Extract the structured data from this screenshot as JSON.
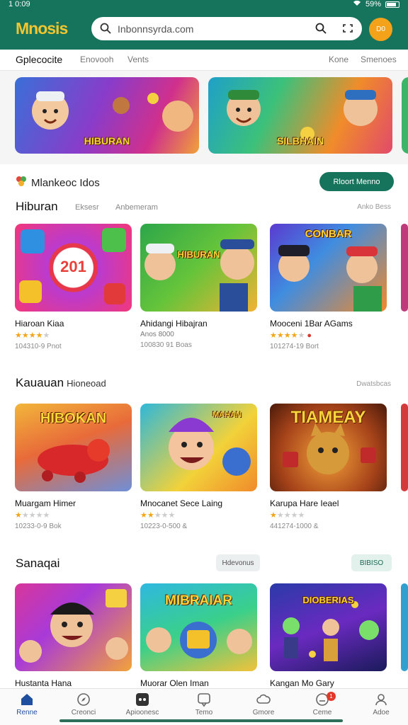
{
  "status_bar": {
    "time": "1 0:09",
    "battery": "59%"
  },
  "header": {
    "logo": "Mnosis",
    "search_text": "Inbonnsyrda.com",
    "avatar_text": "D0"
  },
  "top_nav": [
    {
      "label": "Gplecocite",
      "active": true
    },
    {
      "label": "Enovooh",
      "active": false
    },
    {
      "label": "Vents",
      "active": false
    },
    {
      "label": "Kone",
      "active": false
    },
    {
      "label": "Smenoes",
      "active": false
    }
  ],
  "banners": [
    {
      "title": "HIBURAN"
    },
    {
      "title": "SILBHAIN"
    }
  ],
  "featured": {
    "title": "Mlankeoc Idos",
    "button": "Rloort Menno"
  },
  "sections": [
    {
      "title": "Hiburan",
      "subtitle": "",
      "tabs": [
        "Eksesr",
        "Anbemeram"
      ],
      "see_all": "Anko Bess",
      "cards": [
        {
          "name": "Hiaroan Kiaa",
          "rating": 4,
          "meta": "104310-9 Pnot",
          "thumb_text": "201"
        },
        {
          "name": "Ahidangi Hibajran",
          "rating": 0,
          "rating_text": "Anos 8000",
          "meta": "100830 91 Boas",
          "thumb_text": "HIBURAN"
        },
        {
          "name": "Mooceni 1Bar AGams",
          "rating": 4,
          "meta": "101274-19 Bort",
          "thumb_text": "CONBAR"
        }
      ]
    },
    {
      "title": "Kauauan",
      "subtitle": "Hioneoad",
      "tabs": [],
      "see_all": "Dwatsbcas",
      "cards": [
        {
          "name": "Muargam Himer",
          "rating": 1,
          "meta": "10233-0-9 Bok",
          "thumb_text": "HIBOKAN"
        },
        {
          "name": "Mnocanet Sece Laing",
          "rating": 2,
          "meta": "10223-0-500 &",
          "thumb_text": "MAHAN"
        },
        {
          "name": "Karupa Hare Ieael",
          "rating": 1,
          "meta": "441274-1000 &",
          "thumb_text": "TIAMEAY"
        }
      ]
    },
    {
      "title": "Sanaqai",
      "subtitle": "",
      "chips": [
        "Hdevonus",
        "BIBISO"
      ],
      "cards": [
        {
          "name": "Hustanta Hana",
          "thumb_text": ""
        },
        {
          "name": "Muorar Olen Iman",
          "thumb_text": "MIBRAIAR"
        },
        {
          "name": "Kangan Mo Gary",
          "thumb_text": "DIOBERIAS"
        }
      ]
    }
  ],
  "bottom_nav": [
    {
      "label": "Renne",
      "icon": "home-icon",
      "active": true
    },
    {
      "label": "Creonci",
      "icon": "compass-icon",
      "active": false
    },
    {
      "label": "Apioonesc",
      "icon": "gamepad-icon",
      "active": false
    },
    {
      "label": "Temo",
      "icon": "chat-icon",
      "active": false
    },
    {
      "label": "Gmore",
      "icon": "cloud-icon",
      "active": false
    },
    {
      "label": "Ceme",
      "icon": "bell-icon",
      "active": false,
      "badge": "1"
    },
    {
      "label": "Adoe",
      "icon": "user-icon",
      "active": false
    }
  ],
  "colors": {
    "brand": "#17745c",
    "accent": "#f4a21a",
    "badge": "#e23a2a",
    "star": "#f2a516"
  }
}
